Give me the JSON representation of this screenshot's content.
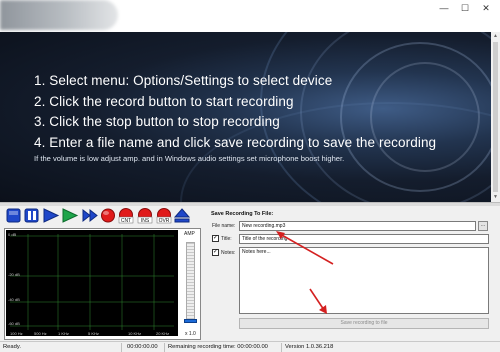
{
  "window": {
    "controls": {
      "minimize": "—",
      "maximize": "☐",
      "close": "✕"
    }
  },
  "banner": {
    "steps": [
      "1. Select menu: Options/Settings to select device",
      "2. Click the record button to start recording",
      "3. Click the stop button to stop recording",
      "4. Enter a file name and click save recording to save the recording"
    ],
    "note": "If the volume is low adjust amp. and in Windows audio settings set microphone boost higher."
  },
  "toolbar": {
    "buttons": [
      {
        "name": "stop",
        "icon": "stop-square-icon",
        "color": "#1f47c9"
      },
      {
        "name": "pause",
        "icon": "pause-icon",
        "color": "#1f47c9"
      },
      {
        "name": "play",
        "icon": "play-icon",
        "color": "#1f47c9"
      },
      {
        "name": "play-green",
        "icon": "play-icon",
        "color": "#1ea54a"
      },
      {
        "name": "fast-forward",
        "icon": "fast-forward-icon",
        "color": "#1f47c9"
      },
      {
        "name": "record",
        "icon": "record-circle-icon",
        "color": "#e01b1b"
      },
      {
        "name": "cnt",
        "label": "CNT",
        "icon": "record-cnt-icon",
        "color": "#e01b1b"
      },
      {
        "name": "ins",
        "label": "INS",
        "icon": "record-ins-icon",
        "color": "#e01b1b"
      },
      {
        "name": "ovr",
        "label": "OVR",
        "icon": "record-ovr-icon",
        "color": "#e01b1b"
      },
      {
        "name": "eject",
        "icon": "eject-icon",
        "color": "#1f47c9"
      }
    ]
  },
  "level": {
    "db_labels": [
      "0 dB",
      "-20 dB",
      "-40 dB",
      "-60 dB"
    ],
    "freq_labels": [
      "100 Hz",
      "500 Hz",
      "1 KHz",
      "5 KHz",
      "10 KHz",
      "20 KHz"
    ],
    "amp_label": "AMP",
    "amp_value": "x 1.0",
    "amp_level": 0.05
  },
  "save": {
    "title": "Save Recording To File:",
    "file_label": "File name:",
    "file_value": "New recording.mp3",
    "browse_label": "...",
    "title_label": "Title:",
    "title_value": "Title of the recording",
    "notes_label": "Notes:",
    "notes_value": "Notes here...",
    "save_button": "Save recording to file"
  },
  "status": {
    "ready": "Ready.",
    "time": "00:00:00.00",
    "remaining": "Remaining recording time: 00:00:00.00",
    "version": "Version 1.0.36.218"
  },
  "colors": {
    "accent_blue": "#1f47c9",
    "record_red": "#e01b1b",
    "arrow_red": "#d42020"
  }
}
